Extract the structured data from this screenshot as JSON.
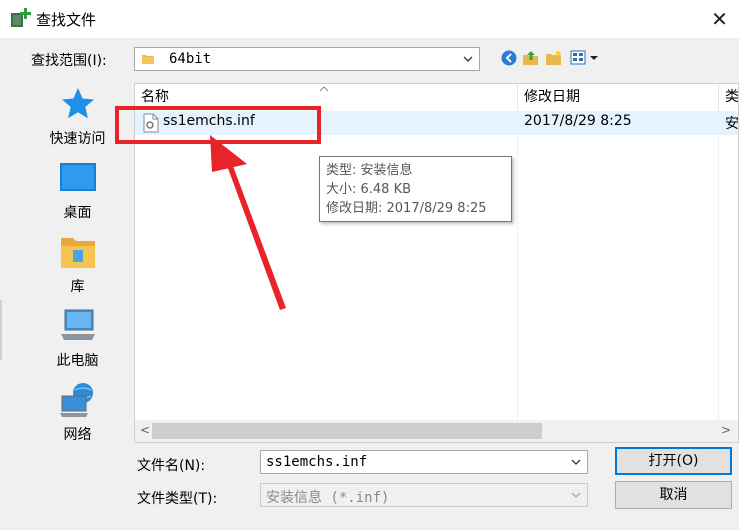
{
  "window": {
    "title": "查找文件",
    "close_glyph": "✕"
  },
  "lookin": {
    "label": "查找范围(I):",
    "value": "64bit"
  },
  "toolbar": {
    "icons": [
      "back-icon",
      "up-folder-icon",
      "new-folder-icon",
      "view-menu-icon"
    ]
  },
  "sidebar": {
    "items": [
      {
        "label": "快速访问",
        "icon": "quick-access-star-icon"
      },
      {
        "label": "桌面",
        "icon": "desktop-icon"
      },
      {
        "label": "库",
        "icon": "library-icon"
      },
      {
        "label": "此电脑",
        "icon": "this-pc-icon"
      },
      {
        "label": "网络",
        "icon": "network-icon"
      }
    ]
  },
  "list": {
    "headers": {
      "name": "名称",
      "date": "修改日期",
      "type": "类"
    },
    "rows": [
      {
        "name": "ss1emchs.inf",
        "date": "2017/8/29 8:25",
        "type": "安"
      }
    ]
  },
  "tooltip": {
    "type_line": "类型: 安装信息",
    "size_line": "大小: 6.48 KB",
    "date_line": "修改日期: 2017/8/29 8:25"
  },
  "filename": {
    "label": "文件名(N):",
    "value": "ss1emchs.inf"
  },
  "filetype": {
    "label": "文件类型(T):",
    "value": "安装信息 (*.inf)"
  },
  "buttons": {
    "open": "打开(O)",
    "cancel": "取消"
  },
  "annotation": {
    "color": "#e8232a"
  }
}
